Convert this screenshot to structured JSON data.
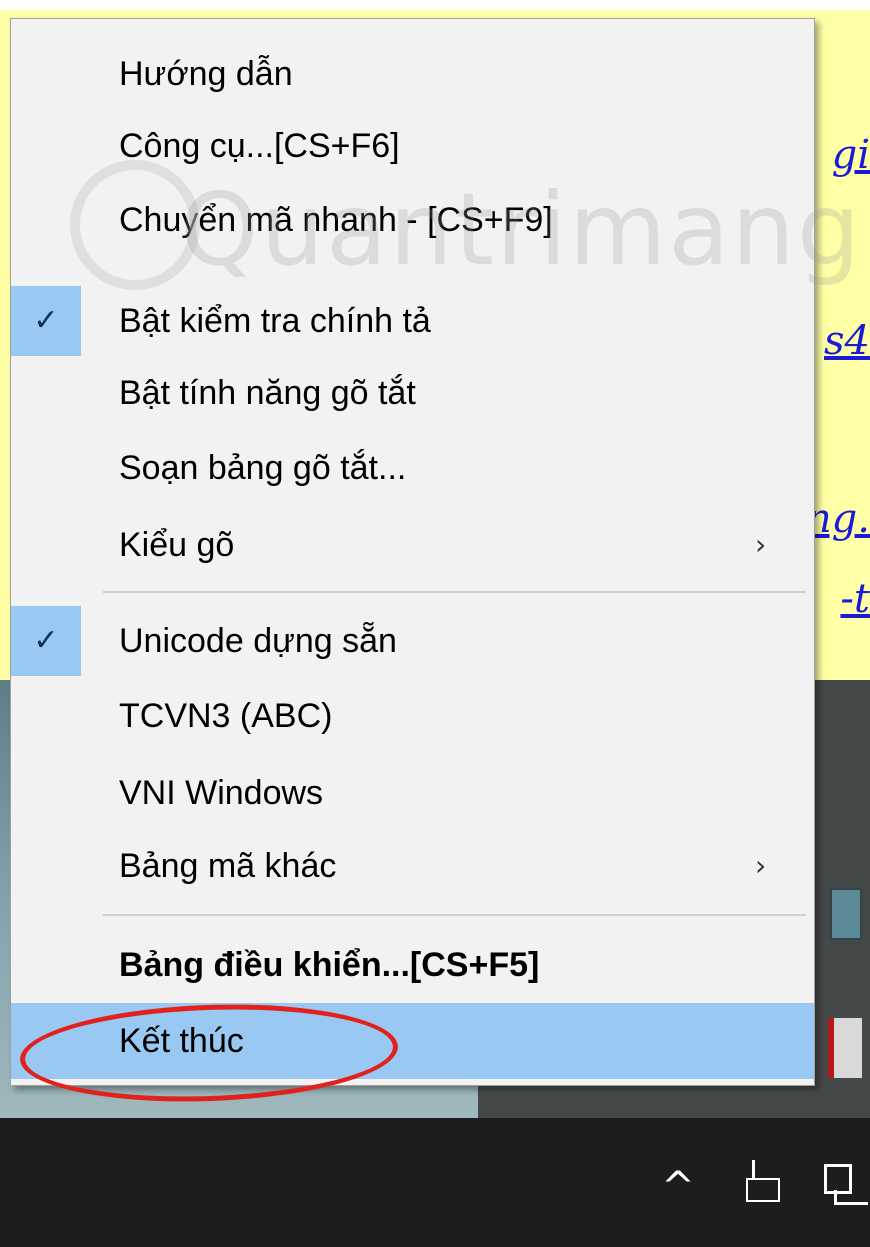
{
  "background": {
    "links": [
      "gi",
      "s4",
      "ng.",
      "-t"
    ]
  },
  "watermark": {
    "text": "Quantrimang"
  },
  "menu": {
    "items": [
      {
        "label": "Hướng dẫn",
        "checked": false,
        "submenu": false
      },
      {
        "label": "Công cụ...[CS+F6]",
        "checked": false,
        "submenu": false
      },
      {
        "label": "Chuyển mã nhanh - [CS+F9]",
        "checked": false,
        "submenu": false
      },
      {
        "label": "Bật kiểm tra chính tả",
        "checked": true,
        "submenu": false
      },
      {
        "label": "Bật tính năng gõ tắt",
        "checked": false,
        "submenu": false
      },
      {
        "label": "Soạn bảng gõ tắt...",
        "checked": false,
        "submenu": false
      },
      {
        "label": "Kiểu gõ",
        "checked": false,
        "submenu": true
      },
      {
        "label": "Unicode dựng sẵn",
        "checked": true,
        "submenu": false
      },
      {
        "label": "TCVN3 (ABC)",
        "checked": false,
        "submenu": false
      },
      {
        "label": "VNI Windows",
        "checked": false,
        "submenu": false
      },
      {
        "label": "Bảng mã khác",
        "checked": false,
        "submenu": true
      },
      {
        "label": "Bảng điều khiển...[CS+F5]",
        "checked": false,
        "submenu": false,
        "bold": true
      },
      {
        "label": "Kết thúc",
        "checked": false,
        "submenu": false,
        "highlighted": true
      }
    ],
    "check_glyph": "✓",
    "submenu_glyph": "›"
  },
  "taskbar": {
    "chevron_glyph": "^",
    "battery_glyph": "x"
  },
  "colors": {
    "menu_bg": "#f2f2f2",
    "highlight": "#99c9f3",
    "annotation": "#e2201c",
    "note_bg": "#ffffa6",
    "taskbar": "#1c1d1f"
  }
}
